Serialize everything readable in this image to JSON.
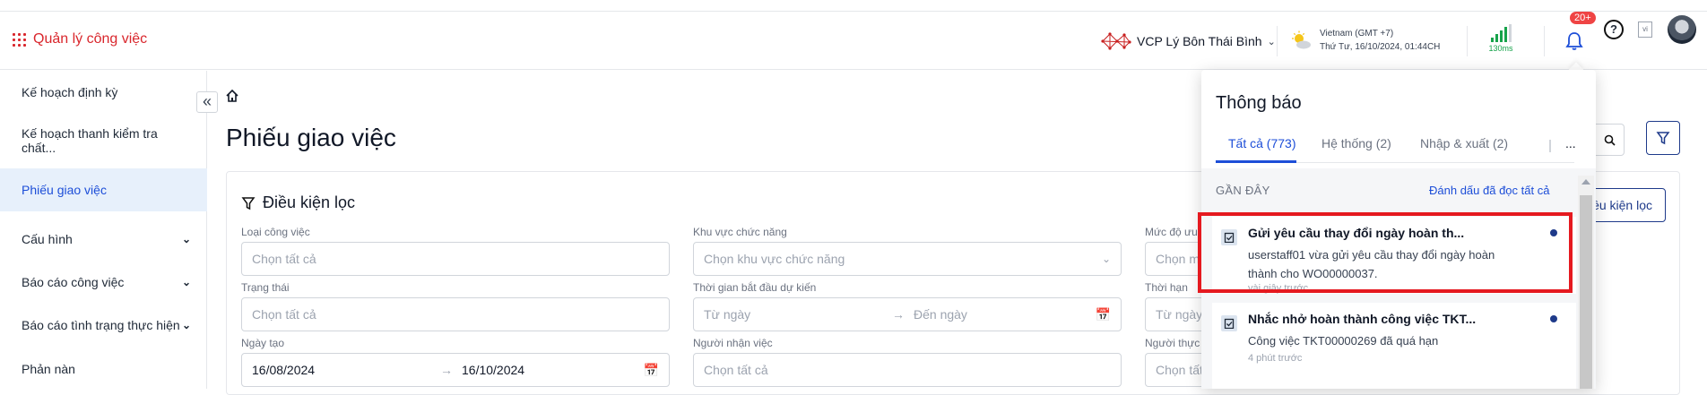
{
  "header": {
    "app_title": "Quản lý công việc",
    "org_name": "VCP Lý Bôn Thái Bình",
    "timezone": "Vietnam (GMT +7)",
    "datetime": "Thứ Tư, 16/10/2024, 01:44CH",
    "latency": "130ms",
    "notif_badge": "20+",
    "help_label": "?",
    "lang_label": "vi"
  },
  "sidebar": {
    "items": [
      {
        "label": "Kế hoạch định kỳ"
      },
      {
        "label": "Kế hoạch thanh kiểm tra chất..."
      },
      {
        "label": "Phiếu giao việc"
      },
      {
        "label": "Cấu hình"
      },
      {
        "label": "Báo cáo công việc"
      },
      {
        "label": "Báo cáo tình trạng thực hiện"
      },
      {
        "label": "Phản nàn"
      }
    ]
  },
  "main": {
    "page_title": "Phiếu giao việc",
    "filter_title": "Điều kiện lọc",
    "filter_button": "ều kiện lọc",
    "fields": {
      "loai_cong_viec": {
        "label": "Loại công việc",
        "placeholder": "Chọn tất cả"
      },
      "khu_vuc": {
        "label": "Khu vực chức năng",
        "placeholder": "Chọn khu vực chức năng"
      },
      "muc_do": {
        "label": "Mức độ ưu",
        "placeholder": "Chọn m"
      },
      "trang_thai": {
        "label": "Trạng thái",
        "placeholder": "Chọn tất cả"
      },
      "thoi_gian": {
        "label": "Thời gian bắt đầu dự kiến",
        "from": "Từ ngày",
        "to": "Đến ngày"
      },
      "thoi_han": {
        "label": "Thời hạn",
        "placeholder": "Từ ngày"
      },
      "ngay_tao": {
        "label": "Ngày tạo",
        "from": "16/08/2024",
        "to": "16/10/2024"
      },
      "nguoi_nhan": {
        "label": "Người nhận việc",
        "placeholder": "Chọn tất cả"
      },
      "nguoi_thuc": {
        "label": "Người thực",
        "placeholder": "Chọn tất"
      }
    }
  },
  "notifications": {
    "title": "Thông báo",
    "tabs": [
      {
        "label": "Tất cả (773)"
      },
      {
        "label": "Hệ thống (2)"
      },
      {
        "label": "Nhập & xuất (2)"
      }
    ],
    "more_label": "...",
    "section_label": "GẦN ĐÂY",
    "mark_all_read": "Đánh dấu đã đọc tất cả",
    "items": [
      {
        "title": "Gửi yêu cầu thay đổi ngày hoàn th...",
        "body": "userstaff01 vừa gửi yêu cầu thay đổi ngày hoàn thành cho WO00000037.",
        "time": "vài giây trước"
      },
      {
        "title": "Nhắc nhở hoàn thành công việc TKT...",
        "body": "Công việc TKT00000269 đã quá hạn",
        "time": "4 phút trước"
      }
    ]
  }
}
